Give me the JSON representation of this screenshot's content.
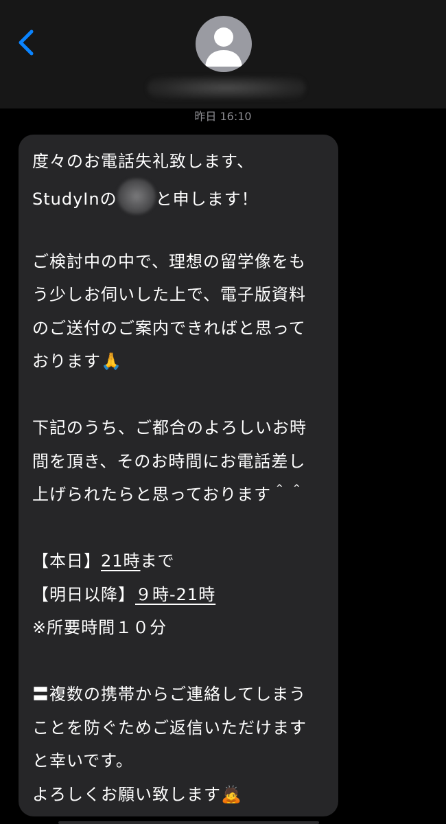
{
  "header": {
    "timestamp": "昨日 16:10"
  },
  "message": {
    "line1": "度々のお電話失礼致します、",
    "line2_pre": "StudyInの",
    "line2_post": "と申します！",
    "line3": "ご検討中の中で、理想の留学像をも",
    "line4": "う少しお伺いした上で、電子版資料",
    "line5": "のご送付のご案内できればと思って",
    "line6": "おります🙏",
    "line7": "下記のうち、ご都合のよろしいお時",
    "line8": "間を頂き、そのお時間にお電話差し",
    "line9": "上げられたらと思っております＾＾",
    "today_label": "【本日】",
    "today_time": "21時",
    "today_suffix": "まで",
    "later_label": "【明日以降】",
    "later_time": "９時-21時",
    "duration": "※所要時間１０分",
    "line13": "〓複数の携帯からご連絡してしまう",
    "line14": "ことを防ぐためご返信いただけます",
    "line15": "と幸いです。",
    "line16_text": "よろしくお願い致します",
    "line16_emoji": "🙇"
  },
  "colors": {
    "header_bg": "#171717",
    "bubble_bg": "#262628",
    "accent": "#0a84ff",
    "timestamp": "#8e8e93"
  },
  "icons": {
    "back": "chevron-left-icon",
    "avatar": "person-icon"
  }
}
